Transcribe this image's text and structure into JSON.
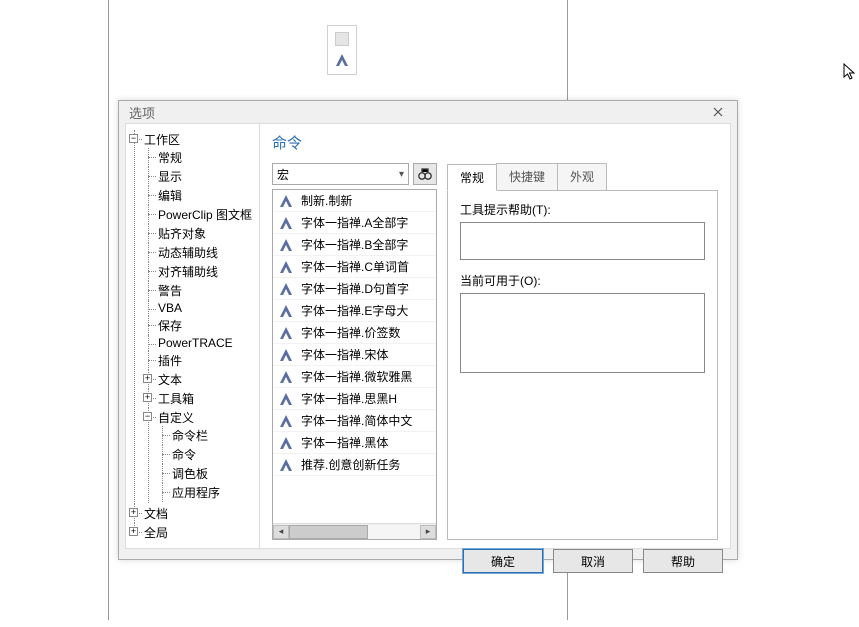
{
  "dialog": {
    "title": "选项",
    "section": "命令",
    "combo_value": "宏",
    "tree": {
      "root": "工作区",
      "items": [
        "常规",
        "显示",
        "编辑",
        "PowerClip 图文框",
        "贴齐对象",
        "动态辅助线",
        "对齐辅助线",
        "警告",
        "VBA",
        "保存",
        "PowerTRACE",
        "插件"
      ],
      "text": "文本",
      "toolbox": "工具箱",
      "custom": "自定义",
      "custom_children": [
        "命令栏",
        "命令",
        "调色板",
        "应用程序"
      ],
      "doc": "文档",
      "global": "全局"
    },
    "list": [
      "制新.制新",
      "字体一指禅.A全部字",
      "字体一指禅.B全部字",
      "字体一指禅.C单词首",
      "字体一指禅.D句首字",
      "字体一指禅.E字母大",
      "字体一指禅.价签数",
      "字体一指禅.宋体",
      "字体一指禅.微软雅黑",
      "字体一指禅.思黑H",
      "字体一指禅.简体中文",
      "字体一指禅.黑体",
      "推荐.创意创新任务"
    ],
    "tabs": [
      "常规",
      "快捷键",
      "外观"
    ],
    "active_tab": 0,
    "fields": {
      "tooltip_label": "工具提示帮助(T):",
      "available_label": "当前可用于(O):"
    },
    "buttons": {
      "ok": "确定",
      "cancel": "取消",
      "help": "帮助"
    }
  }
}
